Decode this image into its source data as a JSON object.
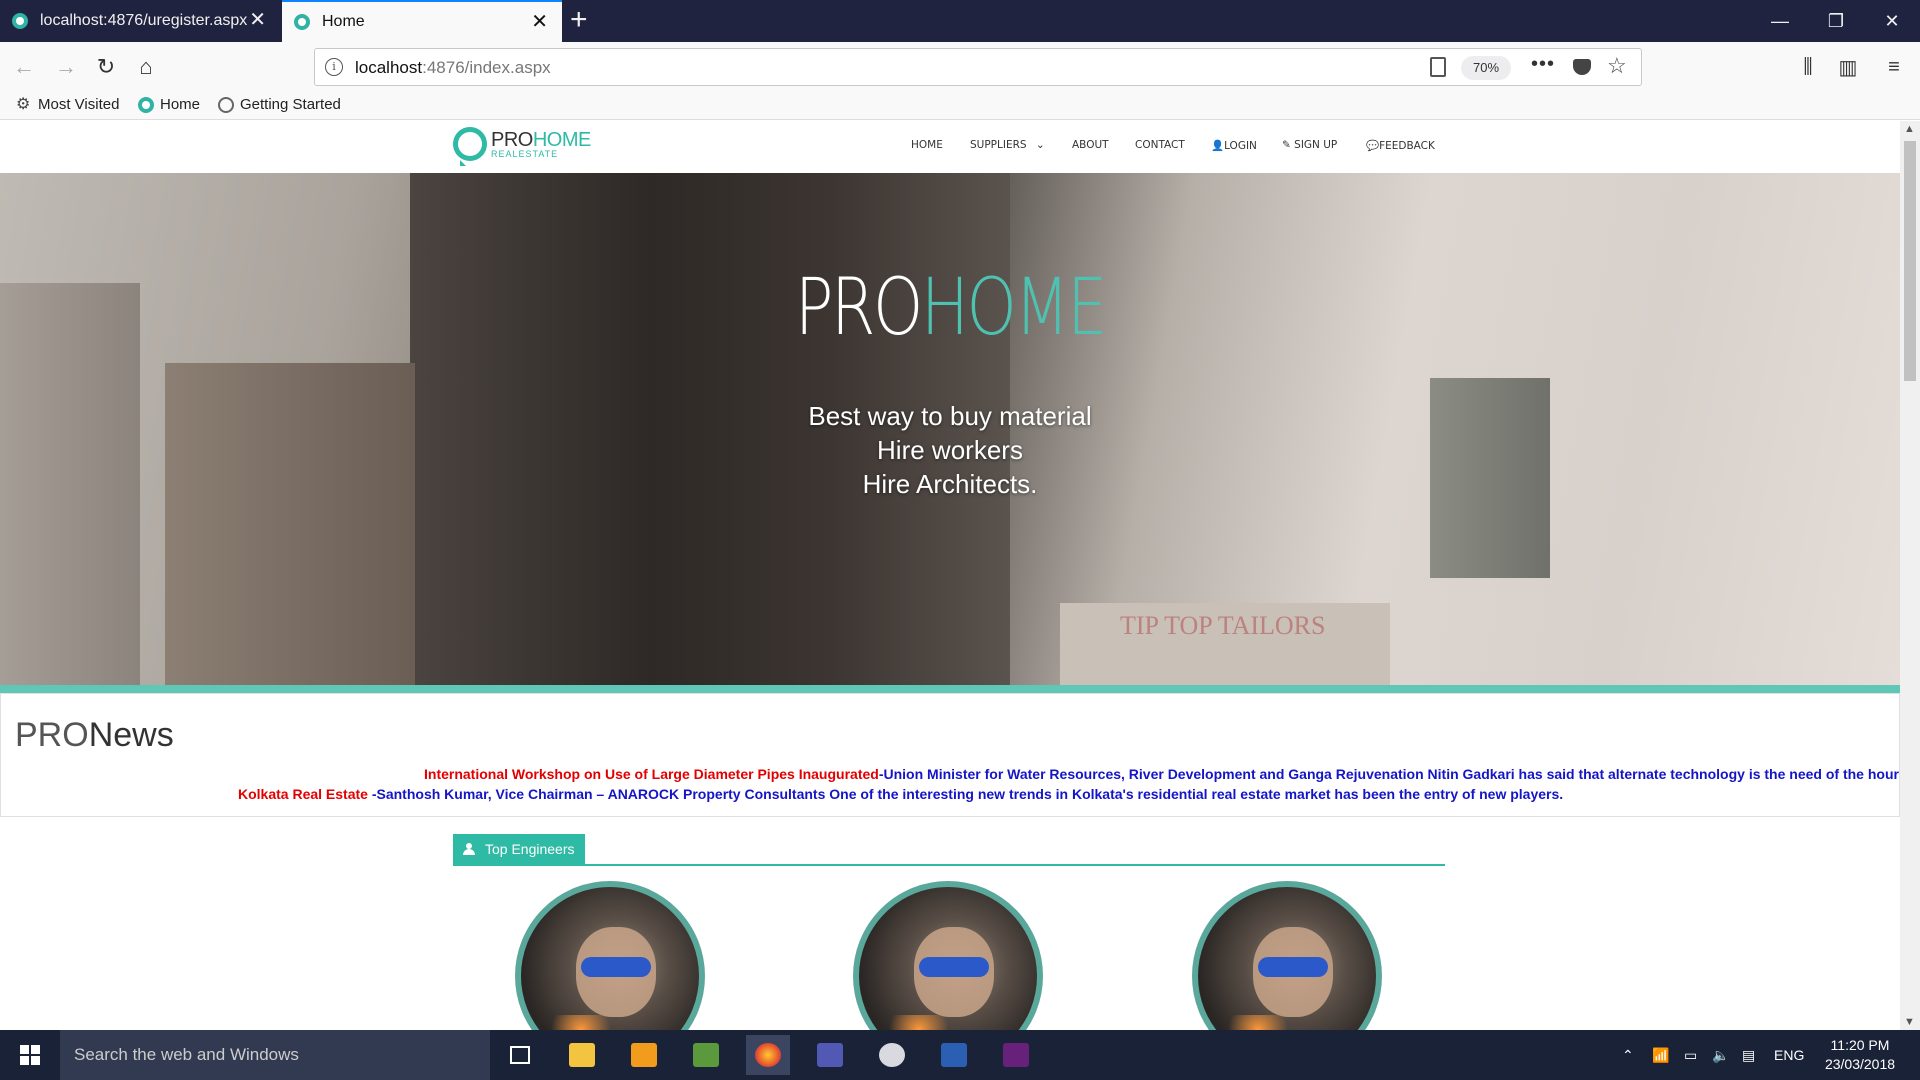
{
  "browser": {
    "tabs": [
      {
        "title": "localhost:4876/uregister.aspx"
      },
      {
        "title": "Home"
      }
    ],
    "url_prefix": "localhost",
    "url_rest": ":4876/index.aspx",
    "zoom": "70%",
    "bookmarks": [
      "Most Visited",
      "Home",
      "Getting Started"
    ]
  },
  "site": {
    "logo_pro": "PRO",
    "logo_home": "HOME",
    "logo_sub": "REALESTATE",
    "menu": [
      "HOME",
      "SUPPLIERS",
      "ABOUT",
      "CONTACT",
      "LOGIN",
      "SIGN UP",
      "FEEDBACK"
    ]
  },
  "hero": {
    "title_pro": "PRO",
    "title_home": "HOME",
    "lines": [
      "Best way to buy material",
      "Hire workers",
      "Hire Architects."
    ],
    "sign_text": "TIP TOP TAILORS"
  },
  "news": {
    "title_pro": "PRO",
    "title_news": "News",
    "items": [
      {
        "headline": "International Workshop on Use of Large Diameter Pipes Inaugurated",
        "body": "-Union Minister for Water Resources, River Development and Ganga Rejuvenation Nitin Gadkari has said that alternate technology is the need of the hour for mega wat"
      },
      {
        "headline": "Kolkata Real Estate ",
        "body": "-Santhosh Kumar, Vice Chairman – ANAROCK Property Consultants One of the interesting new trends in Kolkata's residential real estate market has been the entry of new players."
      }
    ]
  },
  "engineers": {
    "label": "Top Engineers",
    "count_visible": 3
  },
  "taskbar": {
    "search_placeholder": "Search the web and Windows",
    "lang": "ENG",
    "time": "11:20 PM",
    "date": "23/03/2018"
  },
  "colors": {
    "accent": "#2ebaa4",
    "news_red": "#e30000",
    "news_blue": "#1515c8",
    "browser_dark": "#202340",
    "taskbar": "#1a2238"
  }
}
